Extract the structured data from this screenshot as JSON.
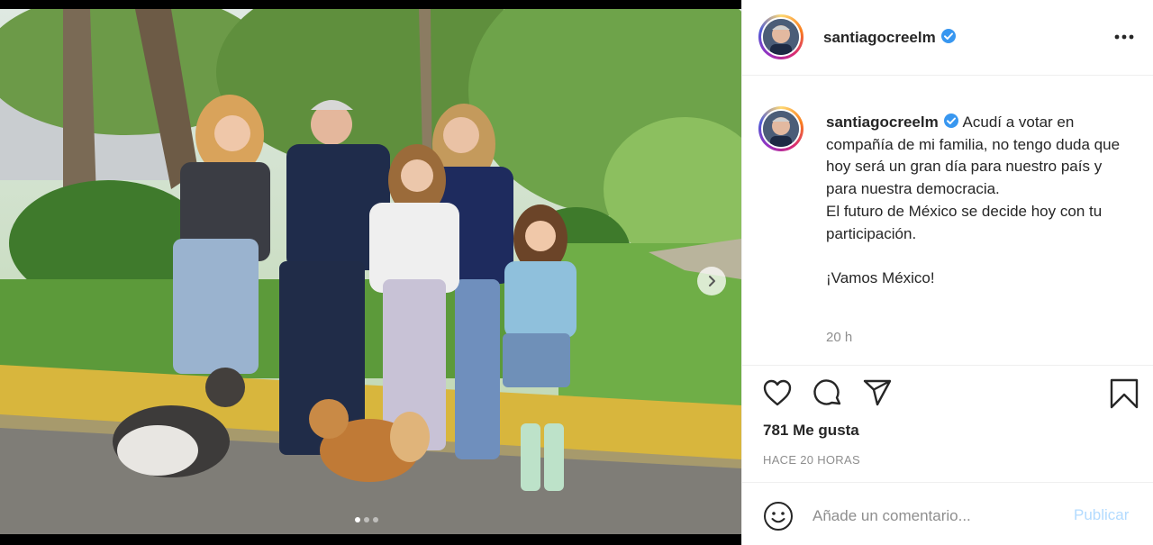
{
  "post": {
    "username": "santiagocreelm",
    "verified": true,
    "caption_line1": "Acudí a votar en compañía de mi familia, no tengo duda que hoy será un gran día para nuestro país y para nuestra democracia.",
    "caption_line2": "El futuro de México se decide hoy con tu participación.",
    "caption_line3": "¡Vamos México!",
    "caption_time": "20 h",
    "likes": "781 Me gusta",
    "timestamp": "HACE 20 HORAS"
  },
  "carousel": {
    "slides_count": 3,
    "active_index": 0
  },
  "icons": {
    "more": "more-options-icon",
    "like": "heart-icon",
    "comment": "comment-icon",
    "share": "share-icon",
    "save": "bookmark-icon",
    "emoji": "emoji-icon",
    "verified": "verified-badge-icon",
    "next": "chevron-right-icon"
  },
  "comment": {
    "placeholder": "Añade un comentario...",
    "publish_label": "Publicar"
  },
  "colors": {
    "verified": "#3897f0",
    "publish_disabled": "#b3dbff",
    "secondary_text": "#8e8e8e"
  }
}
